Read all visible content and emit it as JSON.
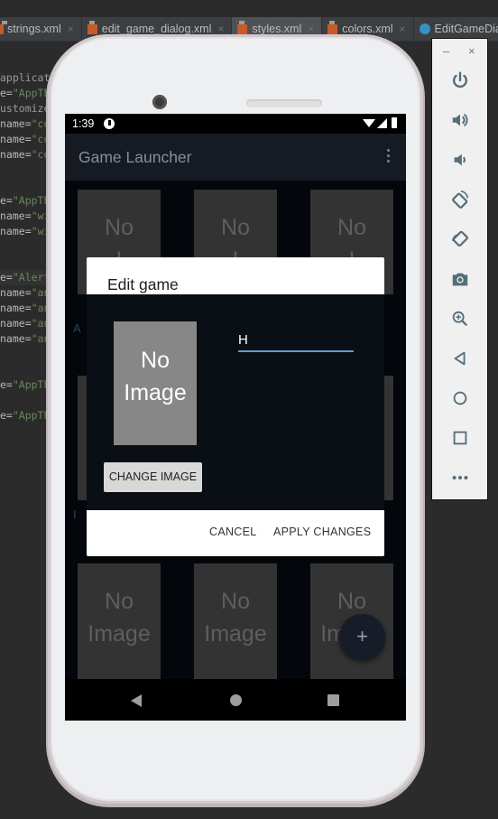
{
  "ide": {
    "tabs": [
      {
        "label": "strings.xml",
        "icon": "xml-file-icon",
        "active": false
      },
      {
        "label": "edit_game_dialog.xml",
        "icon": "xml-file-icon",
        "active": false
      },
      {
        "label": "styles.xml",
        "icon": "xml-file-icon",
        "active": true
      },
      {
        "label": "colors.xml",
        "icon": "xml-file-icon",
        "active": false
      },
      {
        "label": "EditGameDia",
        "icon": "class-file-icon",
        "active": false
      }
    ],
    "code_lines": [
      {
        "pre": "",
        "text": "applicat",
        "kind": "gray"
      },
      {
        "pre": "e=",
        "text": "\"AppTh",
        "kind": "string"
      },
      {
        "pre": "",
        "text": "ustomize",
        "kind": "gray"
      },
      {
        "pre": "name=",
        "text": "\"co",
        "kind": "string"
      },
      {
        "pre": "name=",
        "text": "\"co",
        "kind": "string"
      },
      {
        "pre": "name=",
        "text": "\"co",
        "kind": "string"
      },
      {
        "pre": "",
        "text": "",
        "kind": "gray"
      },
      {
        "pre": "",
        "text": "",
        "kind": "gray"
      },
      {
        "pre": "e=",
        "text": "\"AppTh",
        "kind": "string"
      },
      {
        "pre": "name=",
        "text": "\"wi",
        "kind": "string"
      },
      {
        "pre": "name=",
        "text": "\"wi",
        "kind": "string"
      },
      {
        "pre": "",
        "text": "",
        "kind": "gray"
      },
      {
        "pre": "",
        "text": "",
        "kind": "gray"
      },
      {
        "pre": "e=",
        "text": "\"Alert",
        "kind": "string"
      },
      {
        "pre": "name=",
        "text": "\"an",
        "kind": "string"
      },
      {
        "pre": "name=",
        "text": "\"an",
        "kind": "string"
      },
      {
        "pre": "name=",
        "text": "\"an",
        "kind": "string"
      },
      {
        "pre": "name=",
        "text": "\"an",
        "kind": "string"
      },
      {
        "pre": "",
        "text": "",
        "kind": "gray"
      },
      {
        "pre": "",
        "text": "",
        "kind": "gray"
      },
      {
        "pre": "e=",
        "text": "\"AppTh",
        "kind": "string"
      },
      {
        "pre": "",
        "text": "",
        "kind": "gray"
      },
      {
        "pre": "e=",
        "text": "\"AppTh",
        "kind": "string"
      }
    ]
  },
  "device": {
    "status_bar": {
      "time": "1:39",
      "icons": [
        "pie-notification-icon",
        "wifi-icon",
        "signal-icon",
        "battery-icon"
      ]
    },
    "app_bar": {
      "title": "Game Launcher",
      "menu_icon": "overflow-menu-icon"
    },
    "tiles": {
      "line1": "No",
      "line2": "Image",
      "top_line1": "No",
      "top_line2": "I"
    },
    "section_labels": [
      "A",
      "I"
    ],
    "fab": {
      "label": "+",
      "icon": "add-icon"
    },
    "nav": [
      "back-icon",
      "home-icon",
      "recents-icon"
    ]
  },
  "dialog": {
    "title": "Edit game",
    "preview_line1": "No",
    "preview_line2": "Image",
    "change_image_label": "CHANGE IMAGE",
    "name_value": "H",
    "cancel_label": "CANCEL",
    "apply_label": "APPLY CHANGES"
  },
  "emulator_toolbar": {
    "window_controls": {
      "minimize": "–",
      "close": "×"
    },
    "tools": [
      "power-icon",
      "volume-up-icon",
      "volume-down-icon",
      "rotate-left-icon",
      "rotate-right-icon",
      "camera-icon",
      "zoom-icon",
      "back-icon",
      "home-icon",
      "overview-icon",
      "more-icon"
    ]
  },
  "colors": {
    "app_bar": "#161b23",
    "background": "#03060a",
    "tile": "#333333",
    "dialog_body": "#0a0f16",
    "accent": "#5b9fd0"
  }
}
